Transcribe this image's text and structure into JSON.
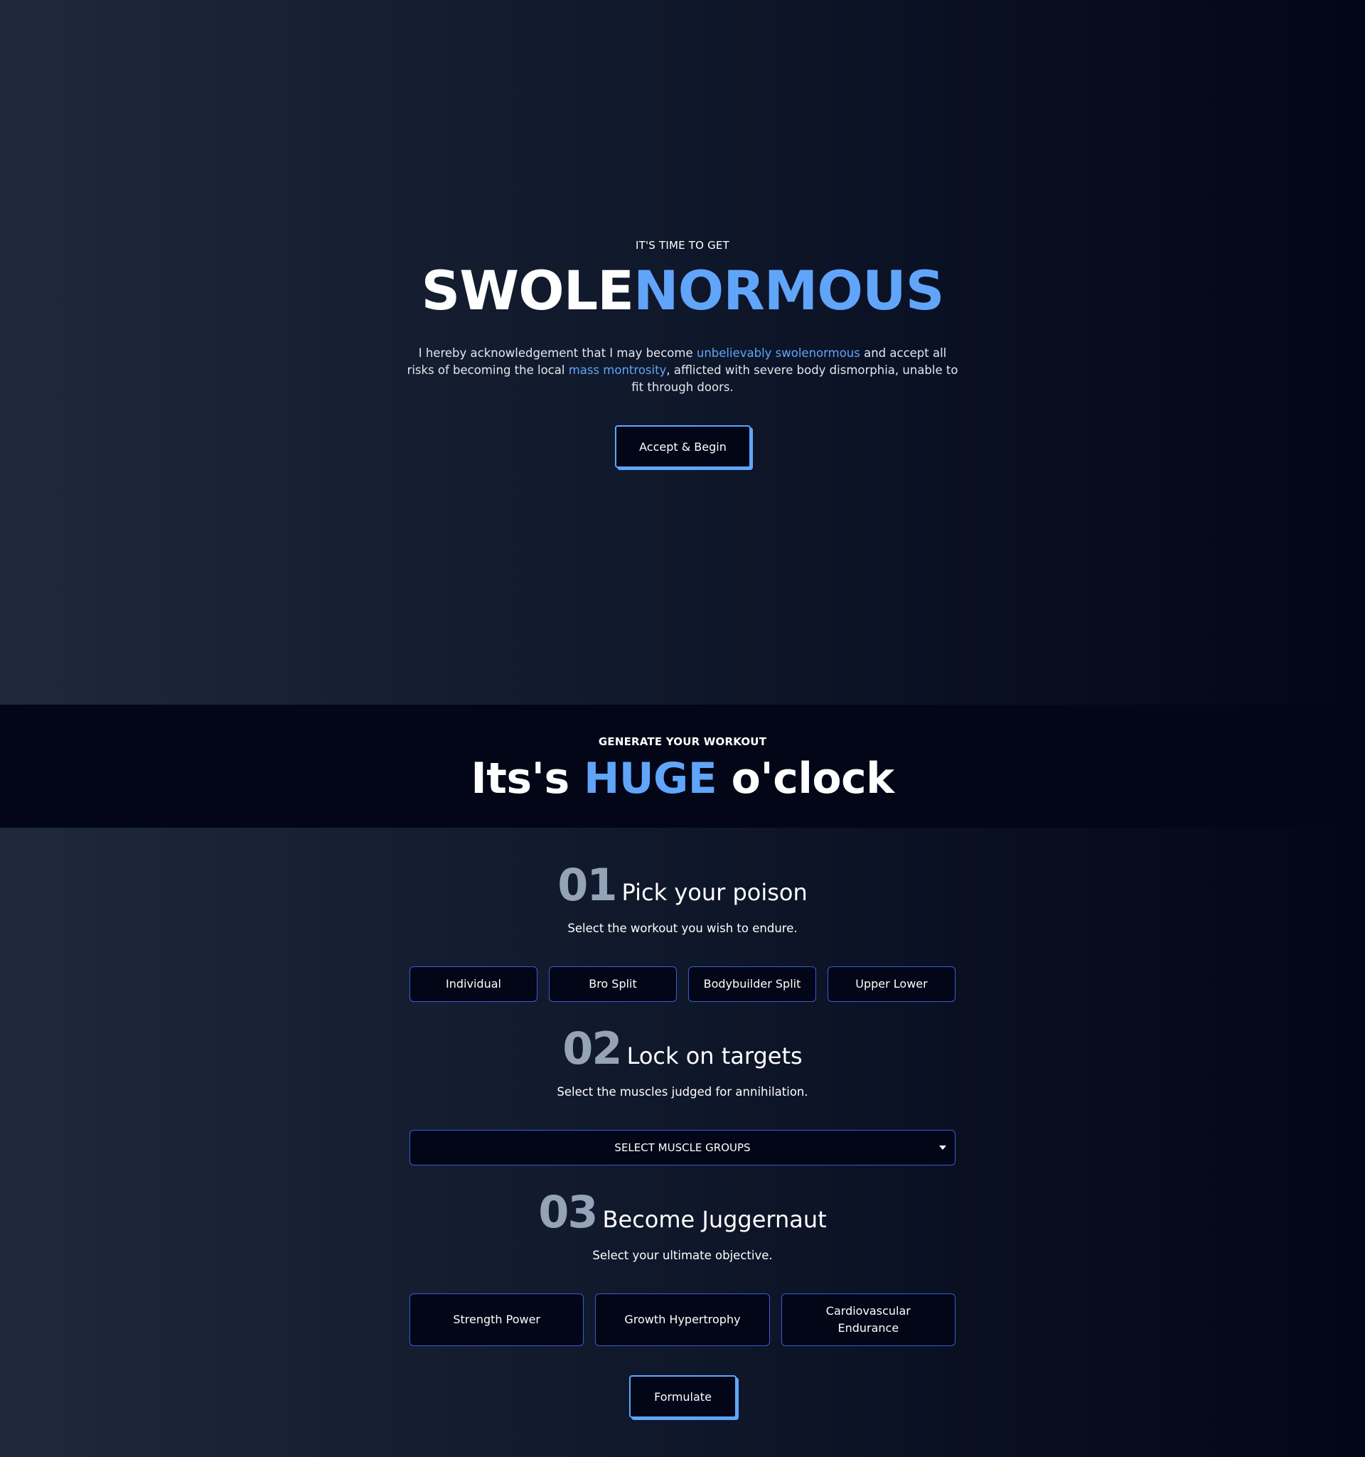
{
  "hero": {
    "eyebrow": "IT'S TIME TO GET",
    "title_part1": "SWOLE",
    "title_part2": "NORMOUS",
    "desc_1": "I hereby acknowledgement that I may become ",
    "desc_hl_1": "unbelievably swolenormous",
    "desc_2": " and accept all risks of becoming the local ",
    "desc_hl_2": "mass montrosity",
    "desc_3": ", afflicted with severe body dismorphia, unable to fit through doors.",
    "button_label": "Accept & Begin"
  },
  "banner": {
    "eyebrow": "GENERATE YOUR WORKOUT",
    "title_part1": "Its's ",
    "title_part2": "HUGE",
    "title_part3": " o'clock"
  },
  "steps": [
    {
      "number": "01",
      "title": "Pick your poison",
      "description": "Select the workout you wish to endure.",
      "options": [
        "Individual",
        "Bro Split",
        "Bodybuilder Split",
        "Upper Lower"
      ]
    },
    {
      "number": "02",
      "title": "Lock on targets",
      "description": "Select the muscles judged for annihilation.",
      "select_label": "SELECT MUSCLE GROUPS"
    },
    {
      "number": "03",
      "title": "Become Juggernaut",
      "description": "Select your ultimate objective.",
      "options": [
        "Strength Power",
        "Growth Hypertrophy",
        "Cardiovascular Endurance"
      ]
    }
  ],
  "formulate_label": "Formulate",
  "colors": {
    "accent": "#60a5fa",
    "background_dark": "#020617",
    "background_mid": "#1e293b",
    "step_number": "#94a3b8",
    "option_border": "#3b5bd8"
  },
  "icons": {
    "select_caret": "caret-down-icon"
  }
}
